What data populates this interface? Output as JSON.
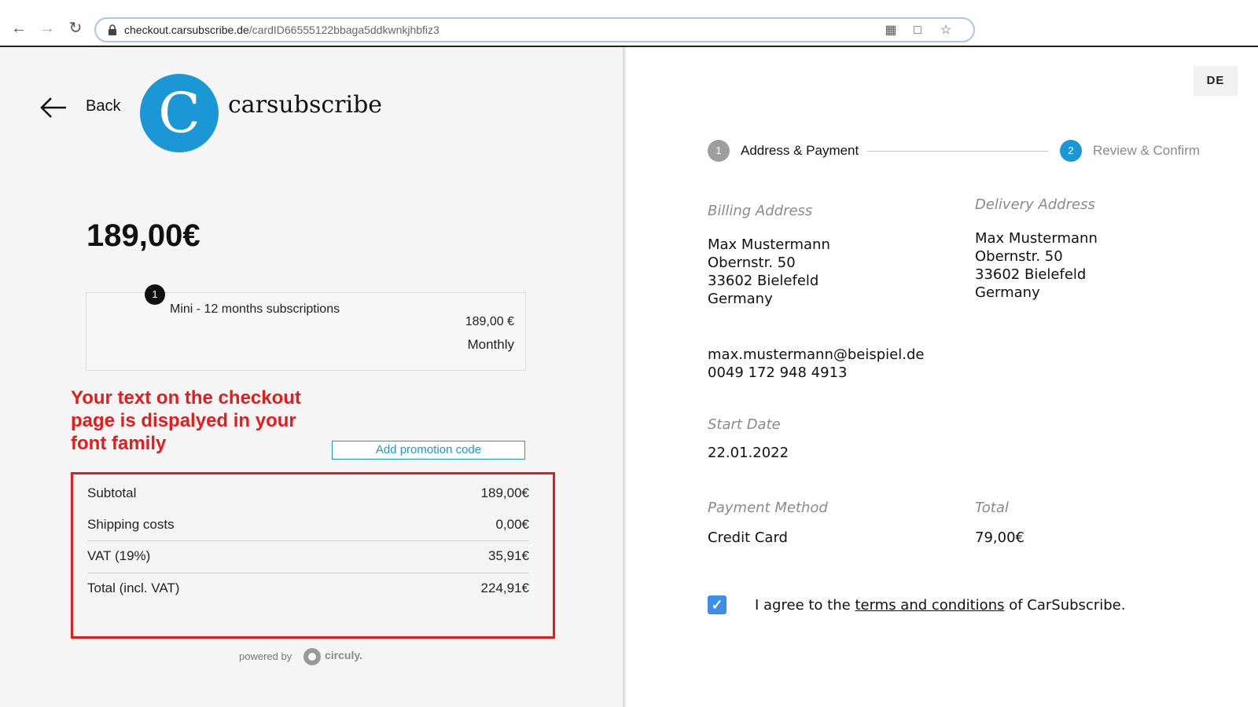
{
  "browser": {
    "url_host": "checkout.carsubscribe.de",
    "url_path": "/cardID66555122bbaga5ddkwnkjhbfiz3",
    "icons": [
      "back-icon",
      "forward-icon",
      "reload-icon",
      "lock-icon",
      "qr-icon",
      "translate-icon",
      "star-icon"
    ]
  },
  "header": {
    "back_label": "Back",
    "logo_letter": "C",
    "brand": "carsubscribe"
  },
  "order": {
    "price": "189,00€",
    "item": {
      "badge": "1",
      "name": "Mini - 12 months subscriptions",
      "price": "189,00 €",
      "period": "Monthly"
    },
    "annotation": "Your text on the checkout page is dispalyed in your font family",
    "promo_label": "Add promotion code",
    "summary": {
      "subtotal_label": "Subtotal",
      "subtotal_value": "189,00€",
      "shipping_label": "Shipping costs",
      "shipping_value": "0,00€",
      "vat_label": "VAT (19%)",
      "vat_value": "35,91€",
      "total_label": "Total (incl. VAT)",
      "total_value": "224,91€"
    },
    "powered_label": "powered by",
    "powered_brand": "circuly."
  },
  "checkout": {
    "lang": "DE",
    "steps": [
      {
        "number": "1",
        "label": "Address & Payment"
      },
      {
        "number": "2",
        "label": "Review & Confirm"
      }
    ],
    "billing_label": "Billing Address",
    "billing": {
      "name": "Max Mustermann",
      "street": "Obernstr. 50",
      "city": "33602 Bielefeld",
      "country": "Germany"
    },
    "delivery_label": "Delivery Address",
    "delivery": {
      "name": "Max Mustermann",
      "street": "Obernstr. 50",
      "city": "33602 Bielefeld",
      "country": "Germany"
    },
    "email": "max.mustermann@beispiel.de",
    "phone": "0049 172 948 4913",
    "start_label": "Start Date",
    "start_value": "22.01.2022",
    "payment_label": "Payment Method",
    "payment_value": "Credit Card",
    "total_label": "Total",
    "total_value": "79,00€",
    "agree_prefix": "I agree to the",
    "agree_link": "terms and conditions",
    "agree_suffix": "of CarSubscribe.",
    "agree_checked": true
  },
  "colors": {
    "accent": "#1b97d6",
    "highlight": "#e31c1c",
    "checkbox": "#3b8fe8"
  }
}
